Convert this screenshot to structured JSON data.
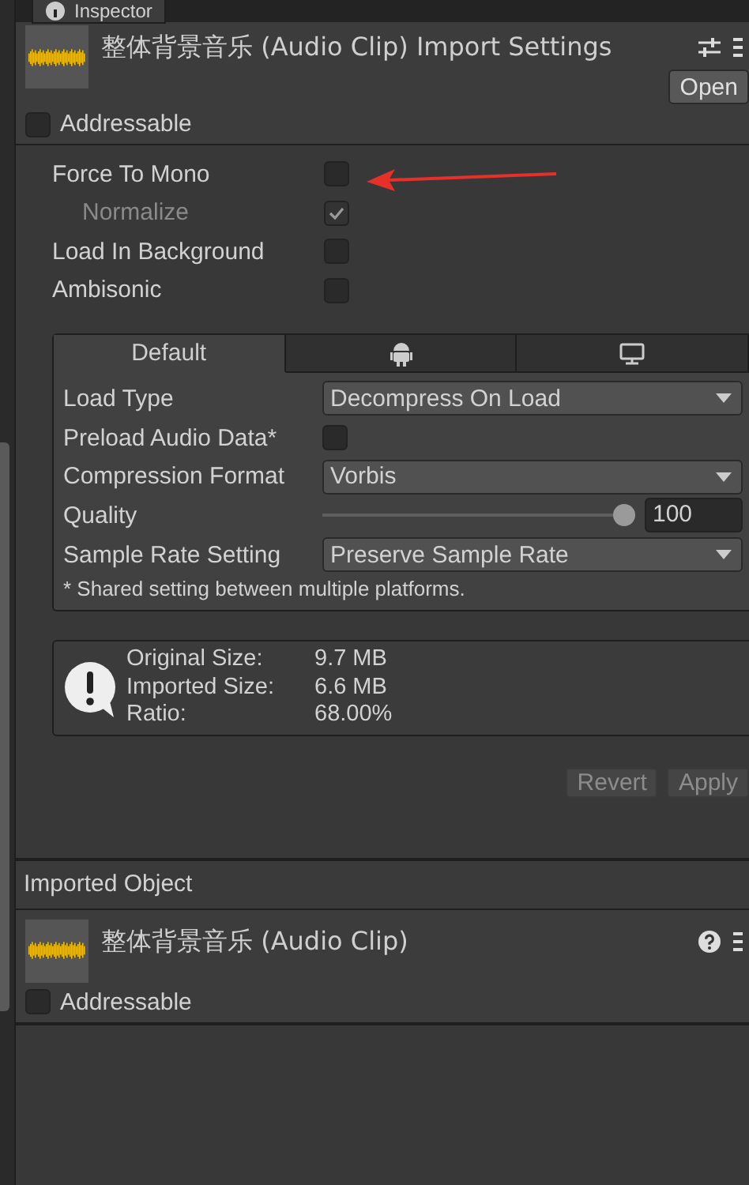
{
  "tab": {
    "label": "Inspector"
  },
  "header": {
    "title": "整体背景音乐 (Audio Clip) Import Settings",
    "open_button": "Open"
  },
  "addressable": {
    "label": "Addressable",
    "checked": false
  },
  "options": [
    {
      "label": "Force To Mono",
      "checked": false,
      "children": [
        {
          "label": "Normalize",
          "checked": true,
          "disabled": true
        }
      ]
    },
    {
      "label": "Load In Background",
      "checked": false
    },
    {
      "label": "Ambisonic",
      "checked": false
    }
  ],
  "platform_tabs": [
    {
      "kind": "text",
      "label": "Default",
      "selected": true
    },
    {
      "kind": "android",
      "selected": false
    },
    {
      "kind": "desktop",
      "selected": false
    }
  ],
  "settings": [
    {
      "kind": "dropdown",
      "label": "Load Type",
      "value": "Decompress On Load"
    },
    {
      "kind": "checkbox",
      "label": "Preload Audio Data*",
      "checked": false
    },
    {
      "kind": "dropdown",
      "label": "Compression Format",
      "value": "Vorbis"
    },
    {
      "kind": "slider",
      "label": "Quality",
      "level": 1.0,
      "value": "100"
    },
    {
      "kind": "dropdown",
      "label": "Sample Rate Setting",
      "value": "Preserve Sample Rate"
    }
  ],
  "note": "* Shared setting between multiple platforms.",
  "info": [
    {
      "label": "Original Size:",
      "value": "9.7 MB"
    },
    {
      "label": "Imported Size:",
      "value": "6.6 MB"
    },
    {
      "label": "Ratio:",
      "value": "68.00%"
    }
  ],
  "buttons": [
    {
      "label": "Revert",
      "disabled": true
    },
    {
      "label": "Apply",
      "disabled": true
    }
  ],
  "imported_object": {
    "heading": "Imported Object",
    "title": "整体背景音乐 (Audio Clip)",
    "addressable": {
      "label": "Addressable",
      "checked": false
    }
  }
}
